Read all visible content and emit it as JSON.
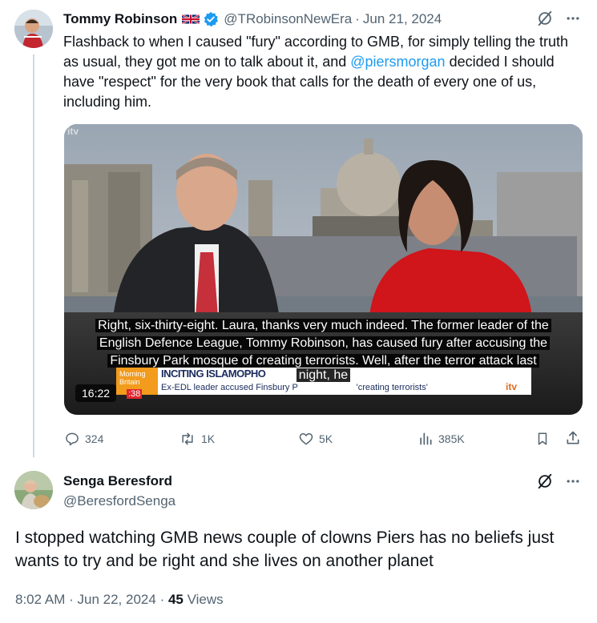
{
  "tweet": {
    "author_name": "Tommy Robinson",
    "flag": "🇬🇧",
    "handle": "@TRobinsonNewEra",
    "separator": "·",
    "date": "Jun 21, 2024",
    "text_before": "Flashback to when I caused \"fury\" according to GMB, for simply telling the truth as usual, they got me on to talk about it, and ",
    "mention": "@piersmorgan",
    "text_after": " decided I should have \"respect\" for the very book that calls for the death of every one of us, including him.",
    "video": {
      "channel_logo": "itv",
      "captions": [
        "Right, six-thirty-eight. Laura, thanks very much indeed. The former leader of the",
        "English Defence League, Tommy Robinson, has caused fury after accusing the",
        "Finsbury Park mosque of creating terrorists. Well, after the terror attack last",
        "night, he"
      ],
      "lower_third_headline": "INCITING ISLAMOPHO",
      "lower_third_sub": "Ex-EDL leader accused Finsbury P",
      "lower_third_quote": "'creating terrorists'",
      "show_tag_line1": "Morning",
      "show_tag_line2": "Britain",
      "show_time": ":38",
      "corner_logo": "itv",
      "duration": "16:22"
    },
    "actions": {
      "replies": "324",
      "retweets": "1K",
      "likes": "5K",
      "views": "385K"
    }
  },
  "reply": {
    "author_name": "Senga Beresford",
    "handle": "@BeresfordSenga",
    "text": "I stopped watching GMB news couple of clowns Piers  has no beliefs just wants to try and be right and she lives on another planet",
    "time": "8:02 AM",
    "separator": "·",
    "date": "Jun 22, 2024",
    "separator2": "·",
    "views_count": "45",
    "views_label": "Views"
  },
  "colors": {
    "accent": "#1d9bf0",
    "muted": "#536471",
    "text": "#0f1419",
    "news_red": "#e31b23"
  }
}
